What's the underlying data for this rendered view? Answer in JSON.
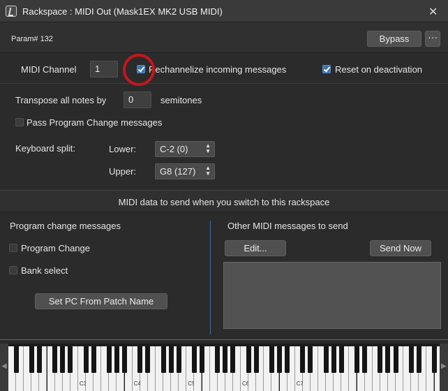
{
  "window": {
    "title": "Rackspace : MIDI Out (Mask1EX MK2 USB MIDI)",
    "logo_icon": "gig-performer-logo",
    "close_glyph": "✕"
  },
  "header": {
    "param_label": "Param# 132",
    "bypass_label": "Bypass",
    "more_label": "···"
  },
  "channel": {
    "label": "MIDI Channel",
    "value": "1",
    "rechannelize_label": "Rechannelize incoming messages",
    "rechannelize_checked": true,
    "reset_label": "Reset on deactivation",
    "reset_checked": true
  },
  "transpose": {
    "label": "Transpose all notes by",
    "value": "0",
    "unit": "semitones"
  },
  "pass_pc": {
    "label": "Pass Program Change messages",
    "checked": false
  },
  "split": {
    "label": "Keyboard split:",
    "lower_label": "Lower:",
    "lower_value": "C-2 (0)",
    "upper_label": "Upper:",
    "upper_value": "G8 (127)"
  },
  "section": {
    "title": "MIDI data to send when you switch to this rackspace"
  },
  "left_panel": {
    "title": "Program change messages",
    "program_change_label": "Program Change",
    "program_change_checked": false,
    "bank_select_label": "Bank select",
    "bank_select_checked": false,
    "set_pc_button": "Set PC From Patch Name"
  },
  "right_panel": {
    "title": "Other MIDI messages to send",
    "edit_button": "Edit...",
    "send_now_button": "Send Now",
    "messages_text": ""
  },
  "keyboard": {
    "octave_labels": [
      "C3",
      "C4",
      "C5",
      "C6",
      "C7"
    ],
    "scroll_left_glyph": "◀",
    "scroll_right_glyph": "▶"
  },
  "colors": {
    "accent": "#3f74b0",
    "highlight_circle": "#c4161c",
    "background": "#2b2b2b"
  }
}
